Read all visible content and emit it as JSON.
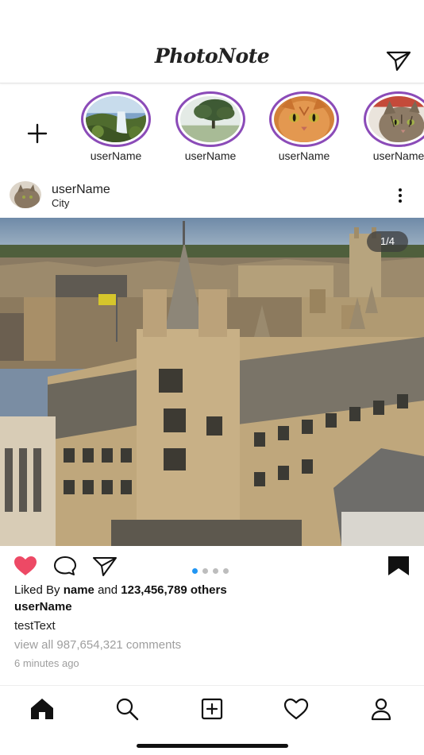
{
  "app": {
    "title": "PhotoNote"
  },
  "stories": [
    {
      "username": "userName",
      "image": "waterfall"
    },
    {
      "username": "userName",
      "image": "tree-in-fog"
    },
    {
      "username": "userName",
      "image": "orange-cat"
    },
    {
      "username": "userName",
      "image": "tabby-cat"
    }
  ],
  "post": {
    "username": "userName",
    "location": "City",
    "image_counter": "1/4",
    "image_index": 1,
    "image_count": 4,
    "liked_prefix": "Liked By",
    "liked_name": "name",
    "liked_and": "and",
    "liked_others": "123,456,789 others",
    "caption_user": "userName",
    "caption_text": "testText",
    "view_comments": "view all 987,654,321 comments",
    "time_ago": "6 minutes ago",
    "liked": true,
    "saved": true
  },
  "icons": {
    "direct_message": "paper-plane-icon",
    "add_story": "plus-icon",
    "more": "more-vertical-icon",
    "like": "heart-icon",
    "comment": "comment-icon",
    "share": "paper-plane-icon",
    "bookmark": "bookmark-icon"
  },
  "tabbar": [
    {
      "name": "home",
      "icon": "home-icon",
      "active": true
    },
    {
      "name": "search",
      "icon": "search-icon",
      "active": false
    },
    {
      "name": "add",
      "icon": "add-square-icon",
      "active": false
    },
    {
      "name": "activity",
      "icon": "heart-outline-icon",
      "active": false
    },
    {
      "name": "profile",
      "icon": "user-icon",
      "active": false
    }
  ],
  "colors": {
    "story_ring": "#8b4bb8",
    "like_active": "#ed4965",
    "page_dot_active": "#2196f3",
    "page_dot_inactive": "#bdbdbd",
    "secondary_text": "#9e9e9e"
  }
}
